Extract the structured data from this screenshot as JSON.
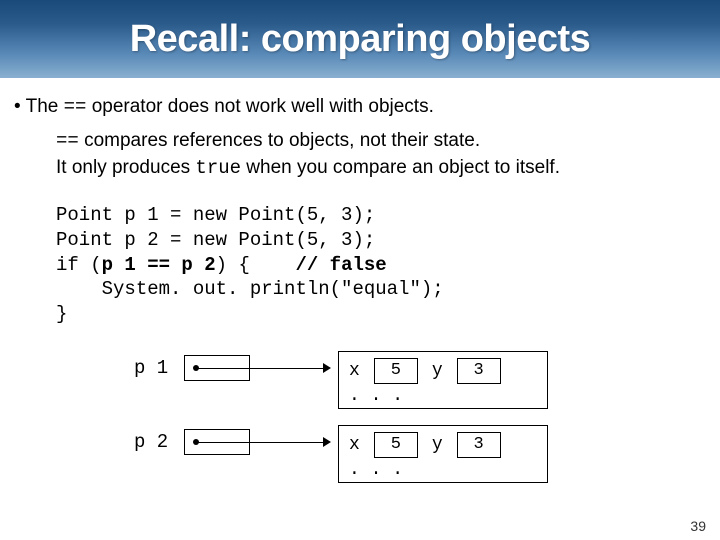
{
  "title": "Recall: comparing objects",
  "bullet": {
    "prefix": "• The ",
    "op": "==",
    "rest": " operator does not work well with objects."
  },
  "sub": {
    "op": "==",
    "line1_rest": " compares references to objects, not their state.",
    "line2_pre": "It only produces ",
    "true_tok": "true",
    "line2_post": " when you compare an object to itself."
  },
  "code": {
    "l1": "Point p 1 = new Point(5, 3);",
    "l2": "Point p 2 = new Point(5, 3);",
    "l3a": "if (",
    "l3b": "p 1 == p 2",
    "l3c": ") {    ",
    "l3d": "// false",
    "l4": "    System. out. println(\"equal\");",
    "l5": "}"
  },
  "diagram": {
    "rows": [
      {
        "var": "p 1",
        "x": "x",
        "xv": "5",
        "y": "y",
        "yv": "3",
        "ell": ". . ."
      },
      {
        "var": "p 2",
        "x": "x",
        "xv": "5",
        "y": "y",
        "yv": "3",
        "ell": ". . ."
      }
    ]
  },
  "page": "39"
}
